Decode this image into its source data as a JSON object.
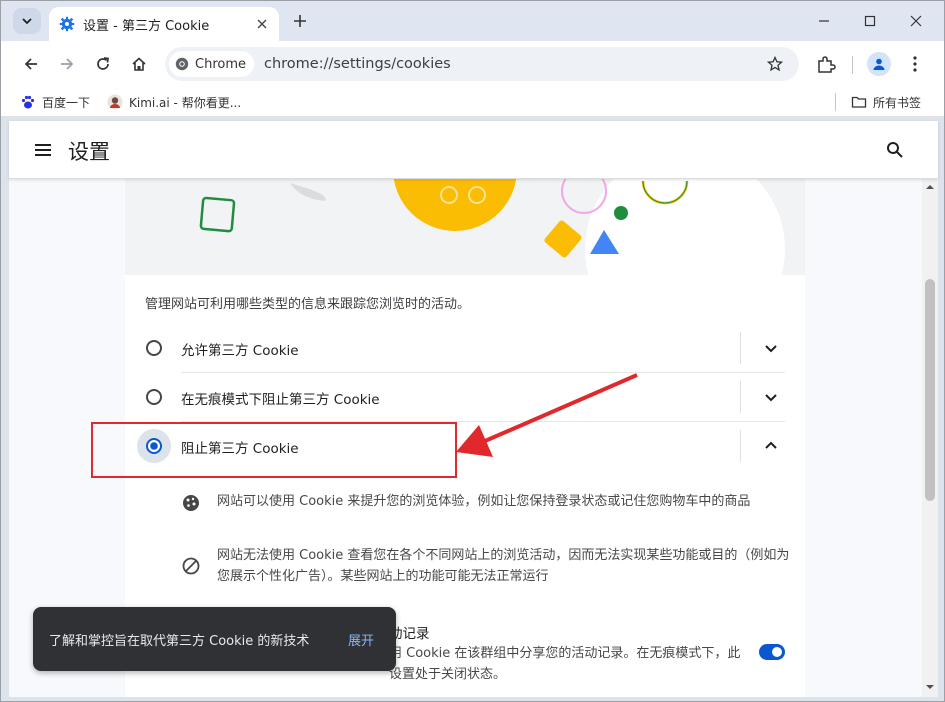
{
  "browser": {
    "tab_title": "设置 - 第三方 Cookie",
    "omnibox_chip": "Chrome",
    "url": "chrome://settings/cookies"
  },
  "bookmarks": {
    "items": [
      {
        "label": "百度一下",
        "icon": "paw-icon"
      },
      {
        "label": "Kimi.ai - 帮你看更...",
        "icon": "kimi-avatar-icon"
      }
    ],
    "all_bookmarks": "所有书签"
  },
  "settings": {
    "title": "设置"
  },
  "cookies": {
    "description": "管理网站可利用哪些类型的信息来跟踪您浏览时的活动。",
    "options": [
      {
        "label": "允许第三方 Cookie",
        "selected": false,
        "expanded": false
      },
      {
        "label": "在无痕模式下阻止第三方 Cookie",
        "selected": false,
        "expanded": false
      },
      {
        "label": "阻止第三方 Cookie",
        "selected": true,
        "expanded": true
      }
    ],
    "details": [
      {
        "icon": "cookie-icon",
        "text": "网站可以使用 Cookie 来提升您的浏览体验，例如让您保持登录状态或记住您购物车中的商品"
      },
      {
        "icon": "block-icon",
        "text_line1": "网站无法使用 Cookie 查看您在各个不同网站上的浏览活动，因而无法实现某些功能或目的（例如为",
        "text_line2": "您展示个性化广告）。某些网站上的功能可能无法正常运行"
      }
    ],
    "partial_title": "动记录",
    "partial_desc_line1": "用 Cookie 在该群组中分享您的活动记录。在无痕模式下，此",
    "partial_desc_line2": "设置处于关闭状态。",
    "toggle_on": true
  },
  "snackbar": {
    "message": "了解和掌控旨在取代第三方 Cookie 的新技术",
    "action": "展开"
  },
  "colors": {
    "accent": "#0b57d0",
    "annotation": "#e0282d"
  }
}
